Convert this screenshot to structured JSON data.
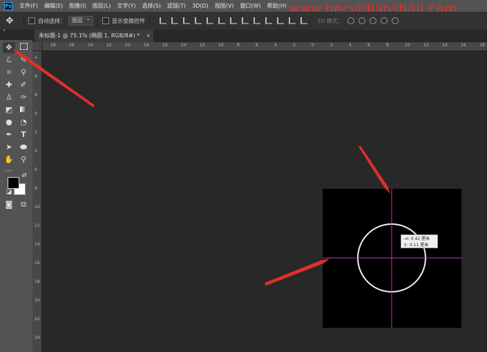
{
  "app": {
    "logo_text": "Ps"
  },
  "menu": [
    "文件(F)",
    "编辑(E)",
    "图像(I)",
    "图层(L)",
    "文字(Y)",
    "选择(S)",
    "滤镜(T)",
    "3D(D)",
    "视图(V)",
    "窗口(W)",
    "帮助(H)"
  ],
  "watermark": "www.hecvidianshaii.com",
  "options_bar": {
    "auto_select_label": "自动选择：",
    "auto_select_value": "图层",
    "show_transform_label": "显示变换控件",
    "mode_3d_label": "3D 模式："
  },
  "collapse_glyph": "«",
  "document_tab": {
    "title": "未标题-1 @ 75.1% (椭圆 1, RGB/8#) *",
    "close": "×"
  },
  "rulers": {
    "horizontal": [
      "28",
      "26",
      "24",
      "22",
      "20",
      "18",
      "16",
      "14",
      "12",
      "10",
      "8",
      "6",
      "4",
      "2",
      "0",
      "2",
      "4",
      "6",
      "8",
      "10",
      "12",
      "14",
      "16",
      "18",
      "20"
    ],
    "vertical": [
      "4",
      "6",
      "8",
      "0",
      "2",
      "4",
      "6",
      "8",
      "10",
      "12",
      "14",
      "16",
      "18",
      "20",
      "22",
      "24",
      "26"
    ]
  },
  "tooltip": {
    "width_line": "→I: 0.42 厘米",
    "height_line": "↕: 0.11 厘米"
  },
  "colors": {
    "accent_red": "#e0302a",
    "guide": "#cc33cc",
    "foreground": "#000000",
    "background": "#ffffff"
  }
}
